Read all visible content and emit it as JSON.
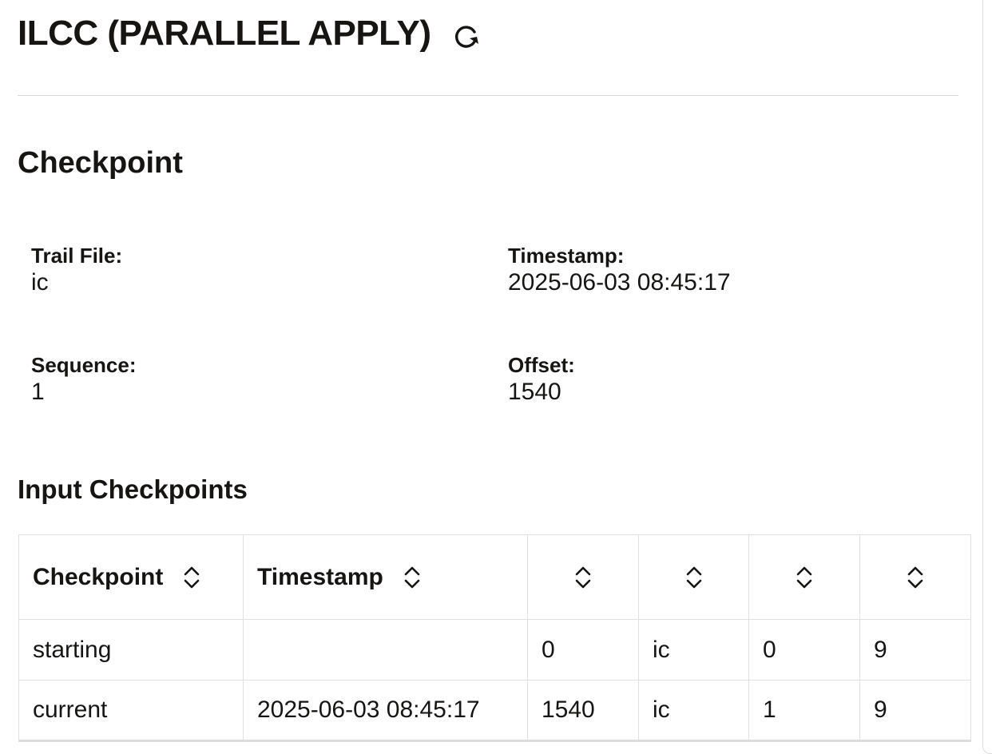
{
  "header": {
    "title": "ILCC (PARALLEL APPLY)",
    "refresh_icon": "refresh-icon"
  },
  "checkpoint": {
    "title": "Checkpoint",
    "trail_file": {
      "label": "Trail File:",
      "value": "ic"
    },
    "timestamp": {
      "label": "Timestamp:",
      "value": "2025-06-03 08:45:17"
    },
    "sequence": {
      "label": "Sequence:",
      "value": "1"
    },
    "offset": {
      "label": "Offset:",
      "value": "1540"
    }
  },
  "input_checkpoints": {
    "title": "Input Checkpoints",
    "columns": [
      "Checkpoint",
      "Timestamp",
      "",
      "",
      "",
      ""
    ],
    "rows": [
      [
        "starting",
        "",
        "0",
        "ic",
        "0",
        "9"
      ],
      [
        "current",
        "2025-06-03 08:45:17",
        "1540",
        "ic",
        "1",
        "9"
      ]
    ],
    "sort_icon": "sort-icon"
  }
}
